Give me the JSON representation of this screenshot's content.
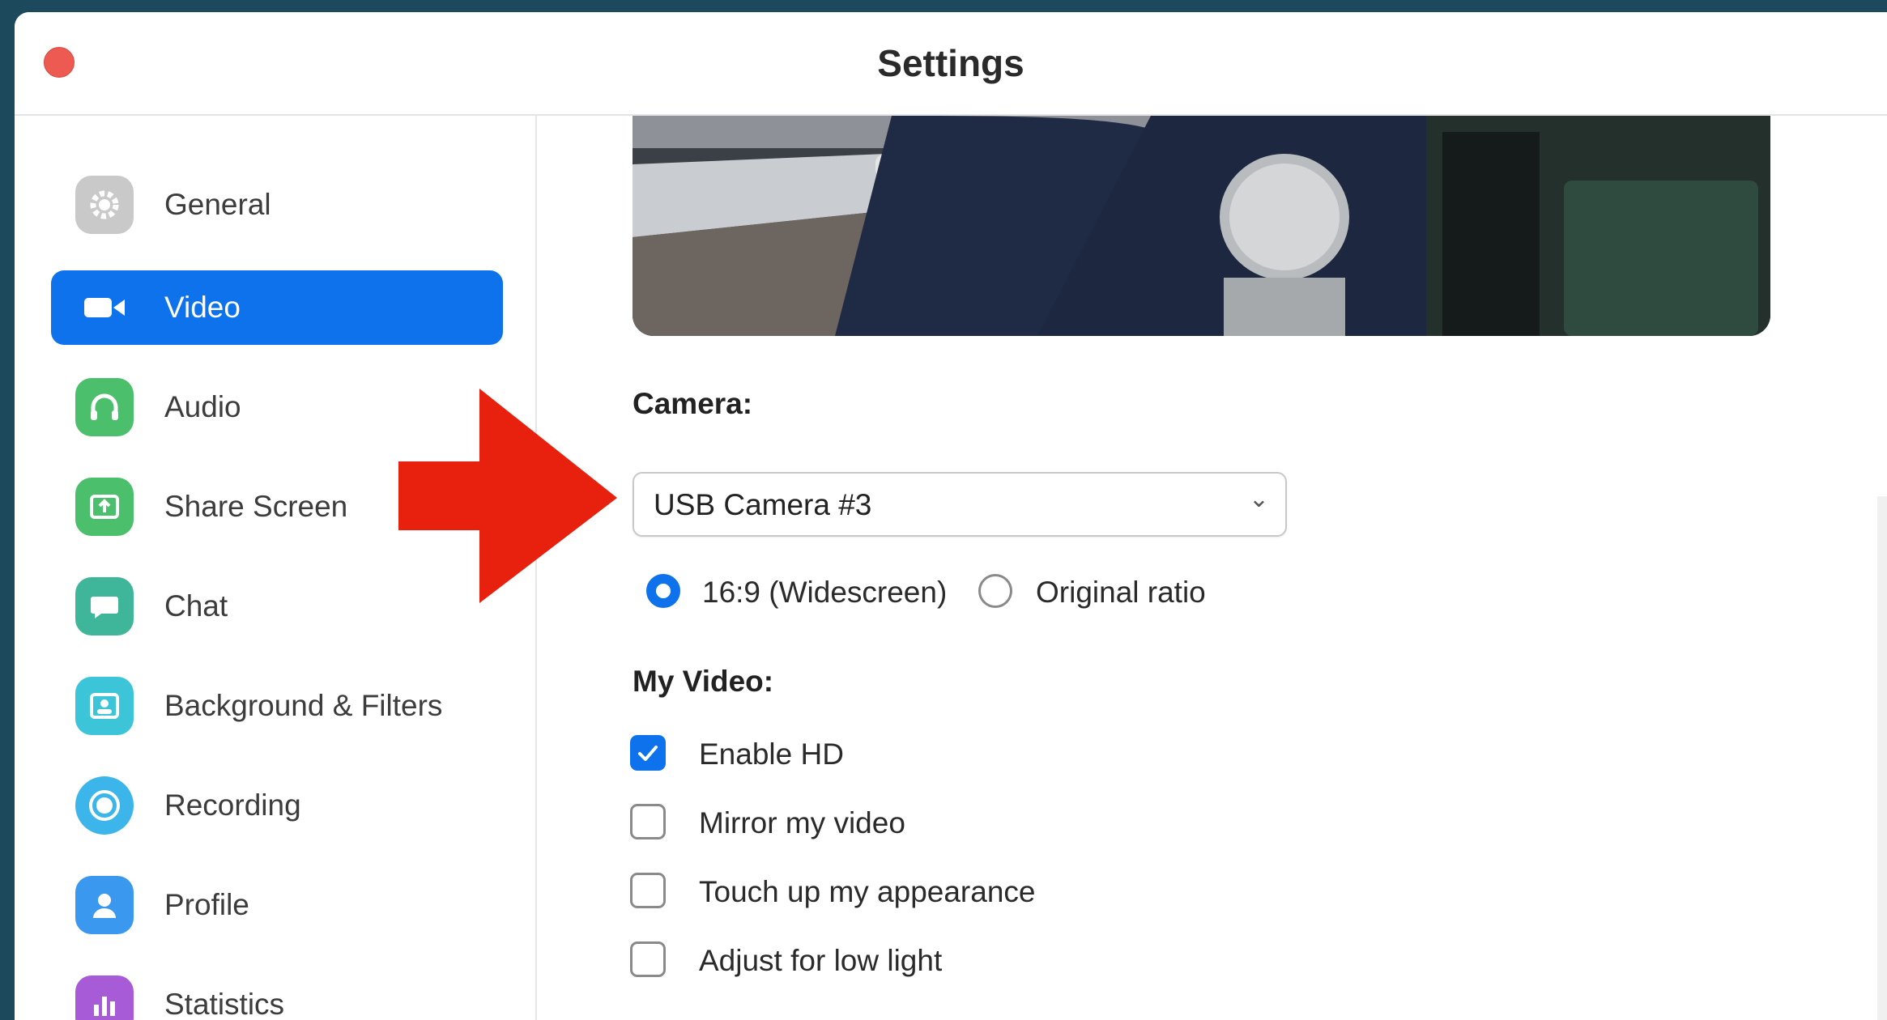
{
  "window": {
    "title": "Settings"
  },
  "colors": {
    "accent": "#0e72ed",
    "arrow": "#e8210f",
    "close": "#ed5a52"
  },
  "sidebar": {
    "items": [
      {
        "label": "General",
        "icon": "gear-icon",
        "active": false
      },
      {
        "label": "Video",
        "icon": "video-camera-icon",
        "active": true
      },
      {
        "label": "Audio",
        "icon": "headphones-icon",
        "active": false
      },
      {
        "label": "Share Screen",
        "icon": "share-screen-icon",
        "active": false
      },
      {
        "label": "Chat",
        "icon": "chat-bubble-icon",
        "active": false
      },
      {
        "label": "Background & Filters",
        "icon": "background-icon",
        "active": false
      },
      {
        "label": "Recording",
        "icon": "record-icon",
        "active": false
      },
      {
        "label": "Profile",
        "icon": "profile-icon",
        "active": false
      },
      {
        "label": "Statistics",
        "icon": "bar-chart-icon",
        "active": false
      }
    ]
  },
  "video": {
    "camera_label": "Camera:",
    "camera_value": "USB Camera #3",
    "ratio_options": [
      {
        "label": "16:9 (Widescreen)",
        "selected": true
      },
      {
        "label": "Original ratio",
        "selected": false
      }
    ],
    "my_video_label": "My Video:",
    "checkboxes": [
      {
        "label": "Enable HD",
        "checked": true
      },
      {
        "label": "Mirror my video",
        "checked": false
      },
      {
        "label": "Touch up my appearance",
        "checked": false
      },
      {
        "label": "Adjust for low light",
        "checked": false
      }
    ]
  }
}
